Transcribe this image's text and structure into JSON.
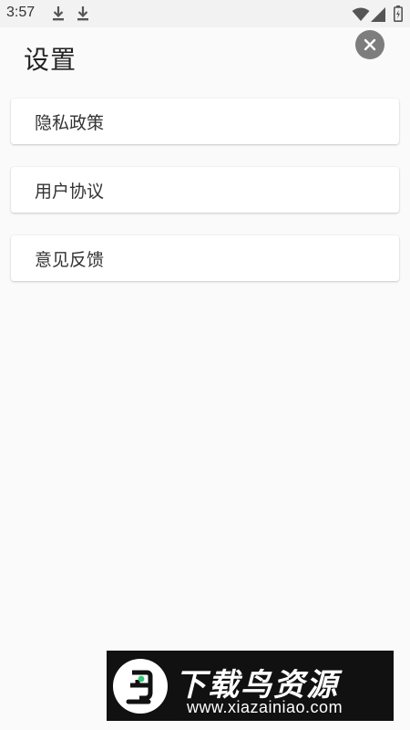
{
  "status_bar": {
    "time": "3:57",
    "icons": [
      "download-icon",
      "download-icon",
      "wifi-icon",
      "signal-icon",
      "battery-icon"
    ]
  },
  "header": {
    "title": "设置",
    "close_icon": "close-icon"
  },
  "menu": {
    "items": [
      {
        "label": "隐私政策"
      },
      {
        "label": "用户协议"
      },
      {
        "label": "意见反馈"
      }
    ]
  },
  "watermark": {
    "title": "下载鸟资源",
    "url": "www.xiazainiao.com"
  },
  "colors": {
    "background": "#fafafa",
    "close_button": "#7d7d7d",
    "watermark_bg": "#111111",
    "logo_accent": "#2ecc71"
  }
}
